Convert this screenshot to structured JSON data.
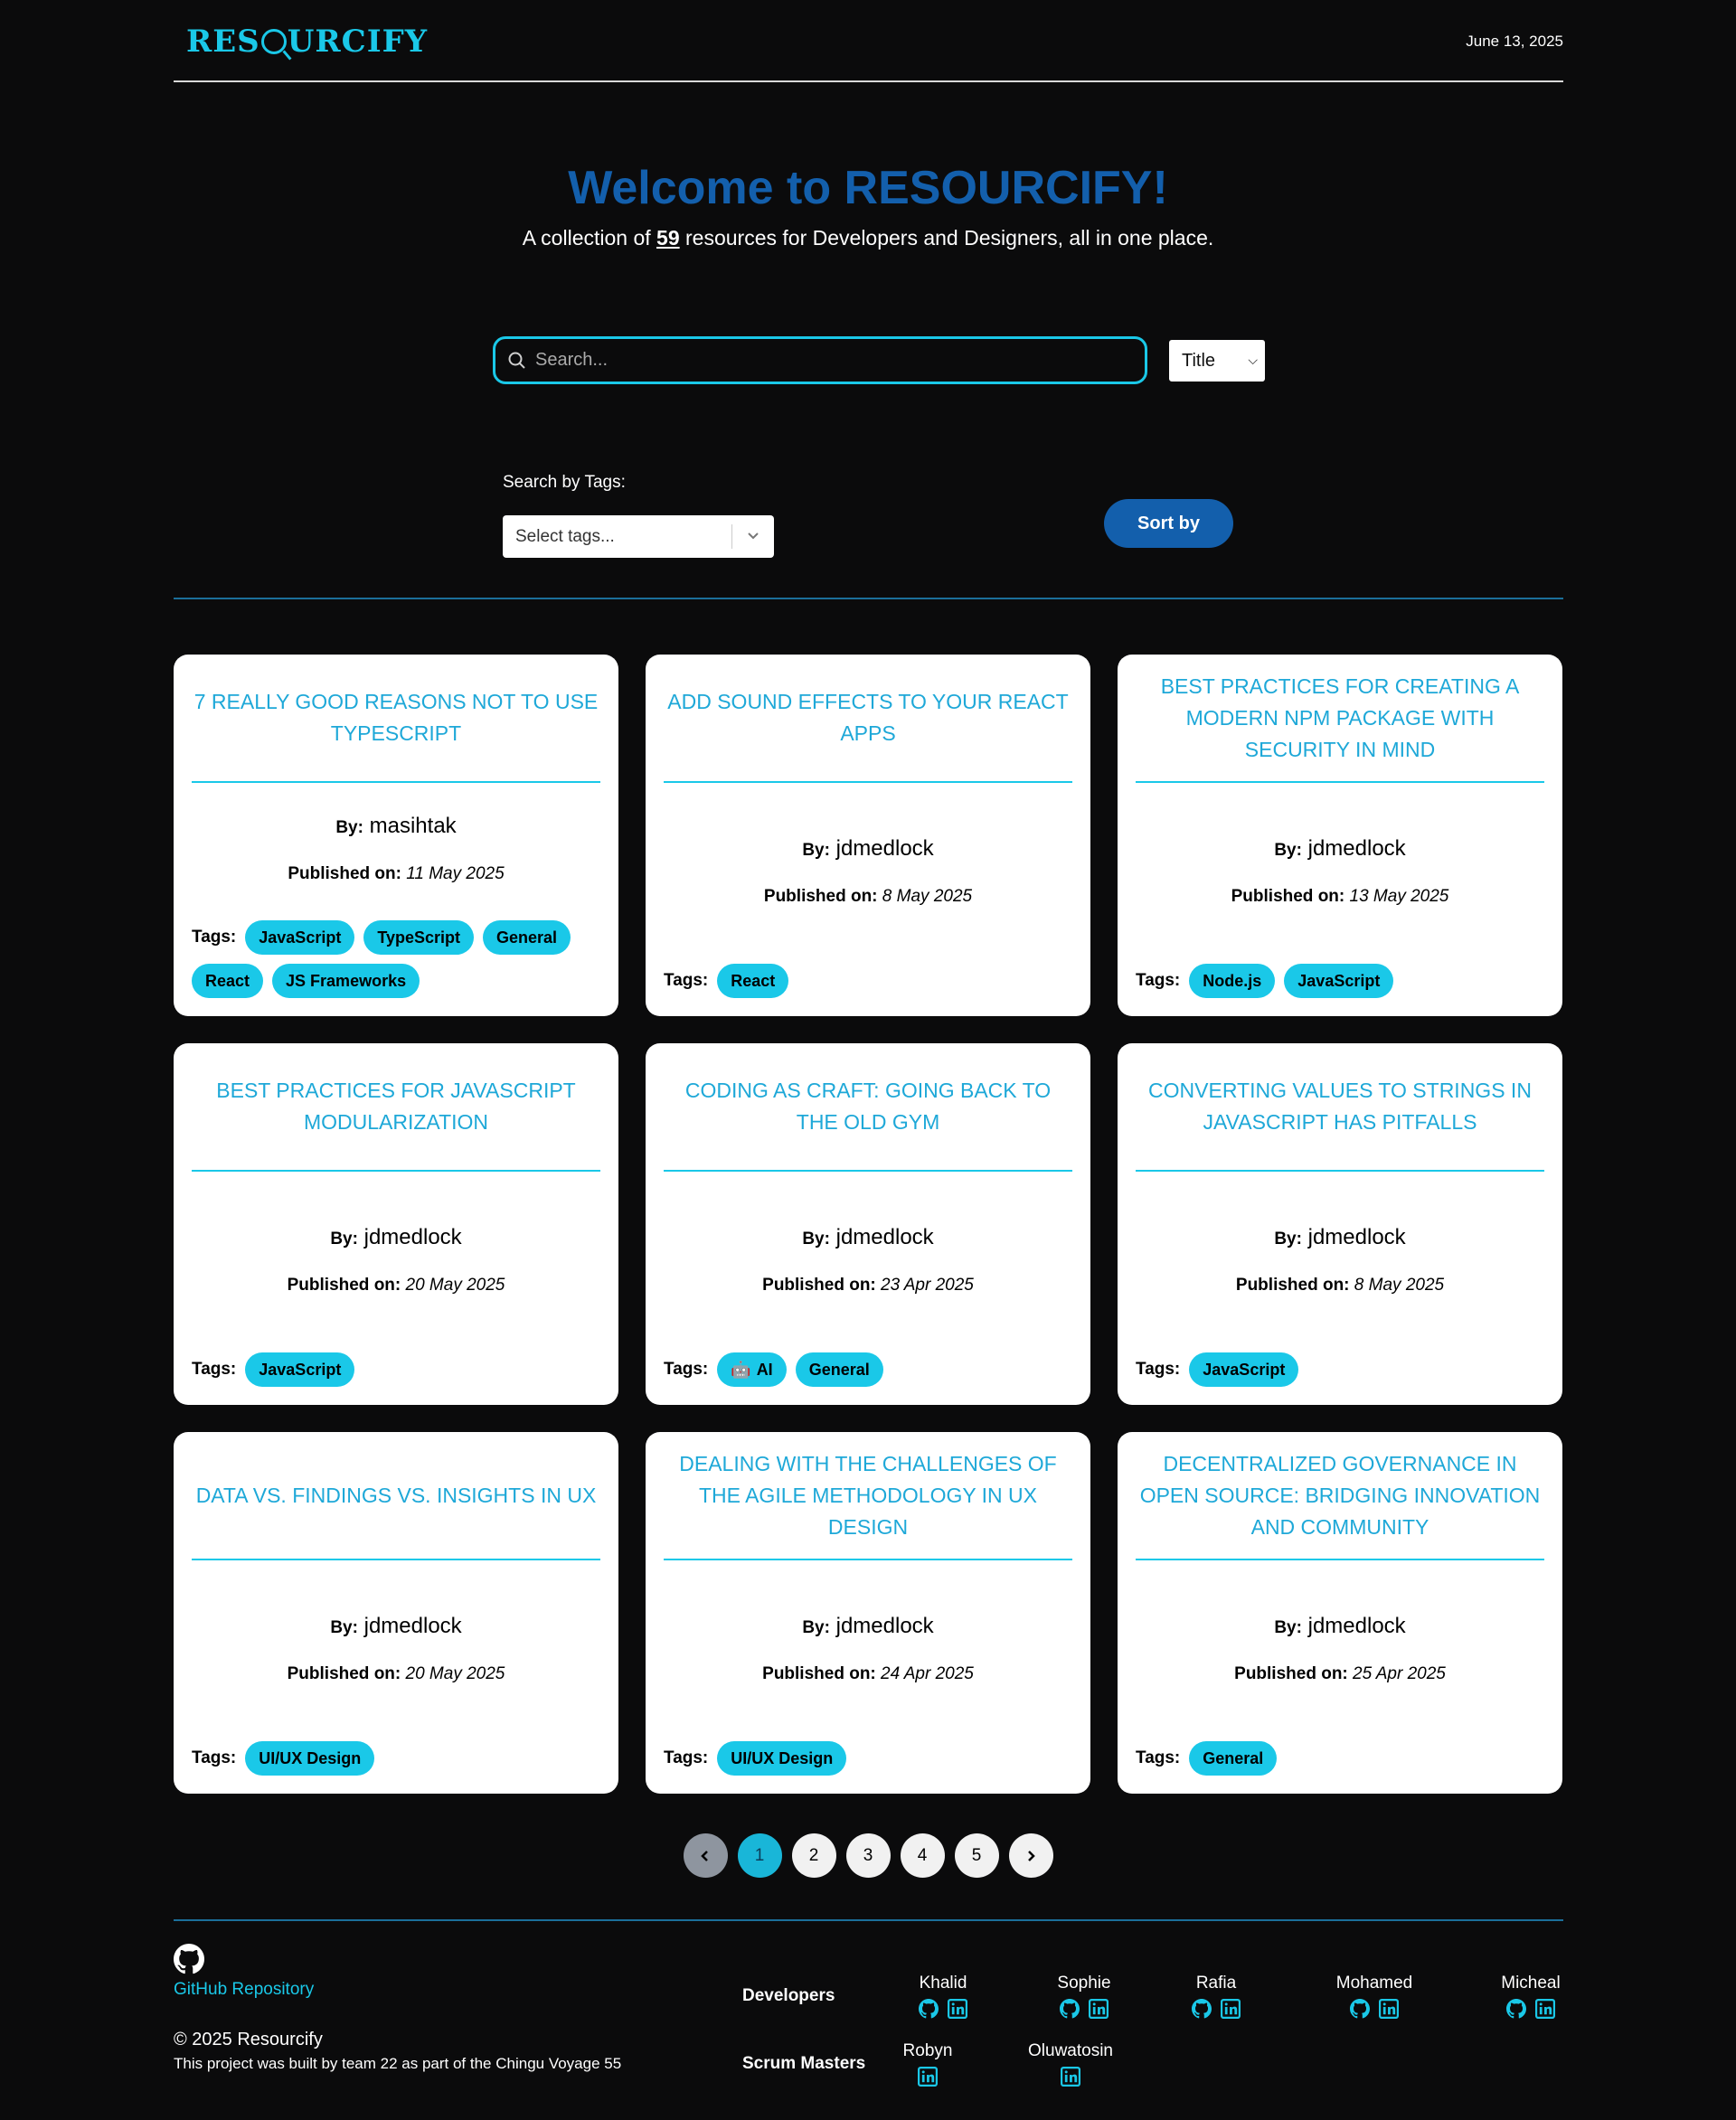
{
  "header": {
    "logo": "RESOURCIFY",
    "logo_pre": "RES",
    "logo_post": "URCIFY",
    "date": "June 13, 2025"
  },
  "hero": {
    "title": "Welcome to RESOURCIFY!",
    "sub_pre": "A collection of ",
    "count": "59",
    "sub_post": " resources for Developers and Designers, all in one place."
  },
  "search": {
    "placeholder": "Search...",
    "field": "Title"
  },
  "tags_filter": {
    "label": "Search by Tags:",
    "placeholder": "Select tags..."
  },
  "sort": {
    "label": "Sort by"
  },
  "card_labels": {
    "by": "By:",
    "published": "Published on:",
    "tags": "Tags:"
  },
  "cards": [
    {
      "title": "7 really good reasons not to use TypeScript",
      "author": "masihtak",
      "date": "11 May 2025",
      "tags": [
        "JavaScript",
        "TypeScript",
        "General",
        "React",
        "JS Frameworks"
      ]
    },
    {
      "title": "Add sound effects to your React apps",
      "author": "jdmedlock",
      "date": "8 May 2025",
      "tags": [
        "React"
      ]
    },
    {
      "title": "Best practices for creating a modern npm package with security in mind",
      "author": "jdmedlock",
      "date": "13 May 2025",
      "tags": [
        "Node.js",
        "JavaScript"
      ]
    },
    {
      "title": "Best practices for JavaScript modularization",
      "author": "jdmedlock",
      "date": "20 May 2025",
      "tags": [
        "JavaScript"
      ]
    },
    {
      "title": "Coding as craft: going back to the old gym",
      "author": "jdmedlock",
      "date": "23 Apr 2025",
      "tags": [
        "AI",
        "General"
      ]
    },
    {
      "title": "Converting values to strings in JavaScript has pitfalls",
      "author": "jdmedlock",
      "date": "8 May 2025",
      "tags": [
        "JavaScript"
      ]
    },
    {
      "title": "Data vs. findings vs. insights in UX",
      "author": "jdmedlock",
      "date": "20 May 2025",
      "tags": [
        "UI/UX Design"
      ]
    },
    {
      "title": "Dealing with the challenges of the agile methodology in UX design",
      "author": "jdmedlock",
      "date": "24 Apr 2025",
      "tags": [
        "UI/UX Design"
      ]
    },
    {
      "title": "Decentralized governance in open source: bridging innovation and community",
      "author": "jdmedlock",
      "date": "25 Apr 2025",
      "tags": [
        "General"
      ]
    }
  ],
  "pagination": {
    "pages": [
      "1",
      "2",
      "3",
      "4",
      "5"
    ],
    "current": "1"
  },
  "footer": {
    "github_link": "GitHub Repository",
    "copyright": "© 2025 Resourcify",
    "built": "This project was built by team 22 as part of the Chingu Voyage 55",
    "developers_label": "Developers",
    "scrum_label": "Scrum Masters",
    "developers": [
      "Khalid",
      "Sophie",
      "Rafia",
      "Mohamed",
      "Micheal"
    ],
    "scrum_masters": [
      "Robyn",
      "Oluwatosin"
    ]
  },
  "colors": {
    "accent": "#1ac8e8",
    "brand_blue": "#135fac",
    "background": "#0b0b0c"
  }
}
